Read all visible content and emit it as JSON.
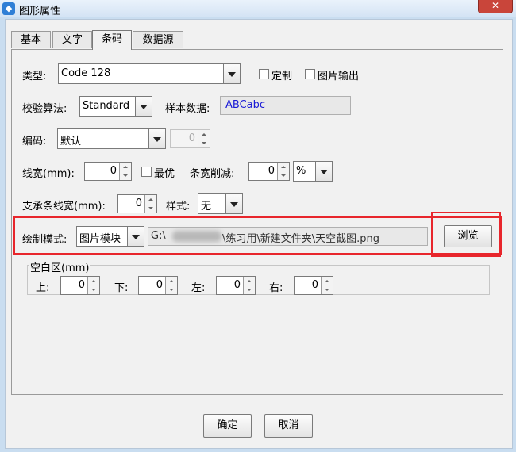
{
  "window": {
    "title": "图形属性",
    "close": "✕"
  },
  "tabs": [
    "基本",
    "文字",
    "条码",
    "数据源"
  ],
  "form": {
    "type_label": "类型:",
    "type_value": "Code 128",
    "custom_label": "定制",
    "image_output_label": "图片输出",
    "checksum_label": "校验算法:",
    "checksum_value": "Standard",
    "sample_label": "样本数据:",
    "sample_value": "ABCabc",
    "encoding_label": "编码:",
    "encoding_value": "默认",
    "encoding_number": "0",
    "line_width_label": "线宽(mm):",
    "line_width_value": "0",
    "optimal_label": "最优",
    "bar_reduce_label": "条宽削减:",
    "bar_reduce_value": "0",
    "bar_reduce_unit": "%",
    "support_bar_label": "支承条线宽(mm):",
    "support_bar_value": "0",
    "style_label": "样式:",
    "style_value": "无",
    "draw_mode_label": "绘制模式:",
    "draw_mode_value": "图片模块",
    "path_prefix": "G:\\",
    "path_suffix": "\\练习用\\新建文件夹\\天空截图.png",
    "browse_label": "浏览"
  },
  "quiet_zone": {
    "title": "空白区(mm)",
    "top_label": "上:",
    "top_value": "0",
    "bottom_label": "下:",
    "bottom_value": "0",
    "left_label": "左:",
    "left_value": "0",
    "right_label": "右:",
    "right_value": "0"
  },
  "buttons": {
    "ok": "确定",
    "cancel": "取消"
  },
  "colors": {
    "sample_text": "#1a1ad6",
    "highlight": "#e8262c"
  }
}
